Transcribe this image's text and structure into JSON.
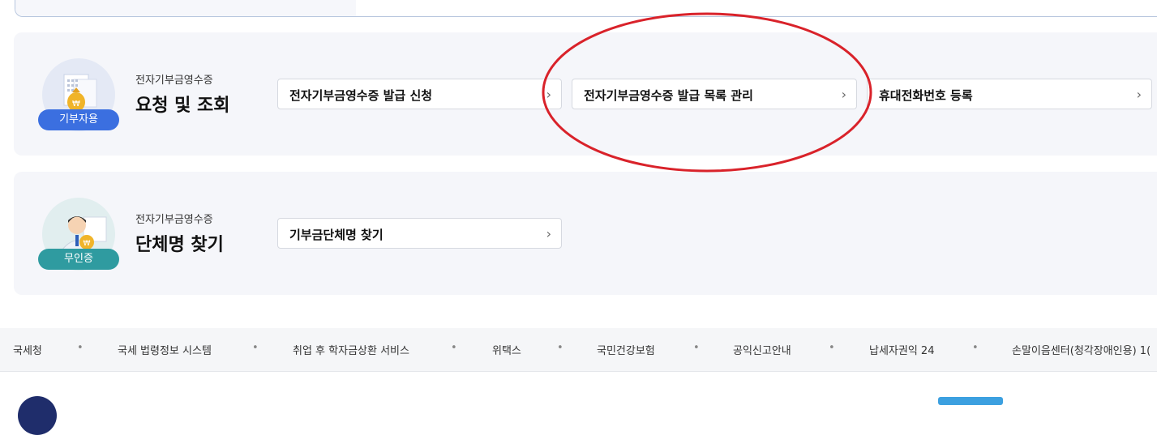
{
  "section1": {
    "badge": "기부자용",
    "sublabel": "전자기부금영수증",
    "title": "요청 및 조회",
    "buttons": [
      {
        "label": "전자기부금영수증 발급 신청"
      },
      {
        "label": "전자기부금영수증 발급 목록 관리"
      },
      {
        "label": "휴대전화번호 등록"
      }
    ]
  },
  "section2": {
    "badge": "무인증",
    "sublabel": "전자기부금영수증",
    "title": "단체명 찾기",
    "buttons": [
      {
        "label": "기부금단체명 찾기"
      }
    ]
  },
  "chevron": "›",
  "footer": {
    "links": [
      "국세청",
      "국세 법령정보 시스템",
      "취업 후 학자금상환 서비스",
      "위택스",
      "국민건강보험",
      "공익신고안내",
      "납세자권익 24",
      "손말이음센터(청각장애인용) 1("
    ],
    "separator": "•"
  },
  "colors": {
    "badge_blue": "#3b6fe0",
    "badge_teal": "#2f9ba0",
    "annotation_red": "#d9222a"
  }
}
